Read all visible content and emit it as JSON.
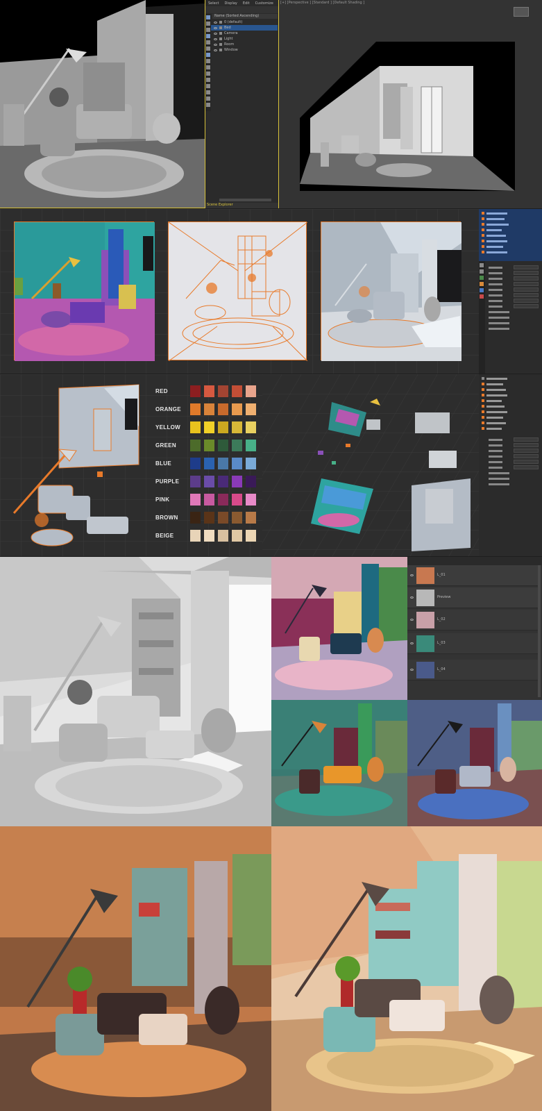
{
  "scene_explorer": {
    "menu": [
      "Select",
      "Display",
      "Edit",
      "Customize"
    ],
    "header": "Name (Sorted Ascending)",
    "items": [
      "0 (default)",
      "Bed",
      "Camera",
      "Light",
      "Room",
      "Window"
    ],
    "footer": "Scene Explorer"
  },
  "viewport_label": "[+] [Perspective ] [Standard ] [Default Shading ]",
  "palette": {
    "rows": [
      {
        "name": "RED",
        "colors": [
          "#8c1e20",
          "#d65940",
          "#a34432",
          "#c34e36",
          "#e8a48c"
        ]
      },
      {
        "name": "ORANGE",
        "colors": [
          "#e07a2a",
          "#d9833a",
          "#c86a2c",
          "#e89a4e",
          "#f0b070"
        ]
      },
      {
        "name": "YELLOW",
        "colors": [
          "#e8c21e",
          "#f0d028",
          "#cca820",
          "#d8b838",
          "#e8d060"
        ]
      },
      {
        "name": "GREEN",
        "colors": [
          "#4c6b2a",
          "#6a8a2a",
          "#2e5a3a",
          "#3c7a5a",
          "#48b088"
        ]
      },
      {
        "name": "BLUE",
        "colors": [
          "#1e3c8a",
          "#2a62b0",
          "#4a78a8",
          "#5a8ac8",
          "#7aaad8"
        ]
      },
      {
        "name": "PURPLE",
        "colors": [
          "#5c3c8a",
          "#6a4ca8",
          "#4a2a78",
          "#8a3ab8",
          "#3a1a58"
        ]
      },
      {
        "name": "PINK",
        "colors": [
          "#e078b8",
          "#c85aa0",
          "#8a2a5a",
          "#d84a8a",
          "#e88ac8"
        ]
      },
      {
        "name": "BROWN",
        "colors": [
          "#3a2414",
          "#5a3418",
          "#7a4a28",
          "#8a5a30",
          "#b87a48"
        ]
      },
      {
        "name": "BEIGE",
        "colors": [
          "#e8d4b8",
          "#f0dcc0",
          "#d8c0a0",
          "#e0c8a4",
          "#ecd6b4"
        ]
      }
    ]
  },
  "layers": {
    "items": [
      "L_01",
      "Preview",
      "L_02",
      "L_03",
      "L_04"
    ]
  },
  "colors": {
    "ui_bg": "#2b2b2b",
    "viewport_bg": "#333333",
    "highlight": "#29568f",
    "selection_orange": "#e87a2a",
    "active_border": "#d8c23a"
  }
}
